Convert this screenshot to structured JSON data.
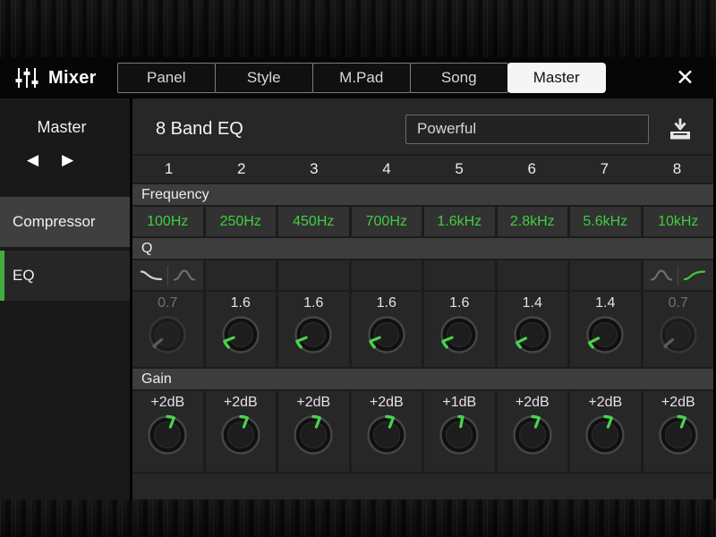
{
  "header": {
    "app_title": "Mixer",
    "close_label": "✕",
    "tabs": [
      {
        "label": "Panel",
        "active": false
      },
      {
        "label": "Style",
        "active": false
      },
      {
        "label": "M.Pad",
        "active": false
      },
      {
        "label": "Song",
        "active": false
      },
      {
        "label": "Master",
        "active": true
      }
    ]
  },
  "sidebar": {
    "title": "Master",
    "prev_label": "◀",
    "next_label": "▶",
    "items": [
      {
        "label": "Compressor",
        "active": false
      },
      {
        "label": "EQ",
        "active": true
      }
    ]
  },
  "main": {
    "title": "8 Band EQ",
    "preset_value": "Powerful",
    "channels": [
      "1",
      "2",
      "3",
      "4",
      "5",
      "6",
      "7",
      "8"
    ],
    "sections": {
      "frequency": {
        "label": "Frequency",
        "values": [
          "100Hz",
          "250Hz",
          "450Hz",
          "700Hz",
          "1.6kHz",
          "2.8kHz",
          "5.6kHz",
          "10kHz"
        ]
      },
      "q": {
        "label": "Q",
        "arc_from": -135,
        "filter_icons": [
          {
            "col": 1,
            "icons": [
              {
                "name": "low-shelf",
                "color": "#d2d2d2"
              },
              {
                "name": "peak",
                "color": "#6e6e6e"
              }
            ]
          },
          {
            "col": 8,
            "icons": [
              {
                "name": "peak",
                "color": "#6e6e6e"
              },
              {
                "name": "high-shelf",
                "color": "#3fca3f"
              }
            ]
          }
        ],
        "cells": [
          {
            "value": "0.7",
            "angle": -130,
            "disabled": true
          },
          {
            "value": "1.6",
            "angle": -112,
            "disabled": false
          },
          {
            "value": "1.6",
            "angle": -112,
            "disabled": false
          },
          {
            "value": "1.6",
            "angle": -112,
            "disabled": false
          },
          {
            "value": "1.6",
            "angle": -112,
            "disabled": false
          },
          {
            "value": "1.4",
            "angle": -117,
            "disabled": false
          },
          {
            "value": "1.4",
            "angle": -117,
            "disabled": false
          },
          {
            "value": "0.7",
            "angle": -130,
            "disabled": true
          }
        ]
      },
      "gain": {
        "label": "Gain",
        "arc_from": 0,
        "cells": [
          {
            "value": "+2dB",
            "angle": 21,
            "disabled": false
          },
          {
            "value": "+2dB",
            "angle": 21,
            "disabled": false
          },
          {
            "value": "+2dB",
            "angle": 21,
            "disabled": false
          },
          {
            "value": "+2dB",
            "angle": 21,
            "disabled": false
          },
          {
            "value": "+1dB",
            "angle": 11,
            "disabled": false
          },
          {
            "value": "+2dB",
            "angle": 21,
            "disabled": false
          },
          {
            "value": "+2dB",
            "angle": 21,
            "disabled": false
          },
          {
            "value": "+2dB",
            "angle": 21,
            "disabled": false
          }
        ]
      }
    }
  },
  "colors": {
    "accent_green": "#3fca3f",
    "knob_indicator": "#49d34c",
    "active_tab_bg": "#f5f5f5",
    "disabled_text": "#6f6f6f"
  }
}
